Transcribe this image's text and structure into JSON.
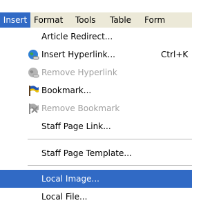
{
  "menubar": {
    "items": [
      {
        "label": "Insert",
        "active": true
      },
      {
        "label": "Format"
      },
      {
        "label": "Tools"
      },
      {
        "label": "Table"
      },
      {
        "label": "Form"
      }
    ]
  },
  "menu": {
    "items": [
      {
        "label": "Article Redirect..."
      },
      {
        "label": "Insert Hyperlink...",
        "shortcut": "Ctrl+K",
        "icon": "globe-link-icon"
      },
      {
        "label": "Remove Hyperlink",
        "icon": "remove-link-icon",
        "disabled": true
      },
      {
        "label": "Bookmark...",
        "icon": "flag-icon"
      },
      {
        "label": "Remove Bookmark",
        "icon": "remove-flag-icon",
        "disabled": true
      },
      {
        "label": "Staff Page Link..."
      },
      {
        "label": "Staff Page Template..."
      },
      {
        "label": "Local Image...",
        "highlighted": true
      },
      {
        "label": "Local File..."
      }
    ]
  },
  "colors": {
    "highlight": "#316ac5",
    "menubar_bg": "#ece9d8",
    "disabled_text": "#a0a0a0"
  }
}
